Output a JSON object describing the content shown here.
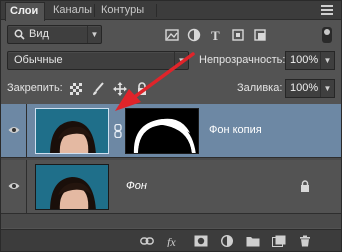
{
  "tabs": [
    {
      "label": "Слои",
      "active": true
    },
    {
      "label": "Каналы",
      "active": false
    },
    {
      "label": "Контуры",
      "active": false
    }
  ],
  "filter": {
    "label": "Вид"
  },
  "blend": {
    "label": "Обычные",
    "opacity_label": "Непрозрачность:",
    "opacity_value": "100%"
  },
  "lock": {
    "label": "Закрепить:",
    "fill_label": "Заливка:",
    "fill_value": "100%"
  },
  "layers": [
    {
      "name": "Фон копия",
      "selected": true,
      "has_mask": true,
      "locked": false
    },
    {
      "name": "Фон",
      "selected": false,
      "has_mask": false,
      "locked": true
    }
  ],
  "footer_icons": [
    "link-icon",
    "fx-icon",
    "add-mask-icon",
    "adjustment-icon",
    "group-icon",
    "new-layer-icon",
    "trash-icon"
  ],
  "colors": {
    "selected_layer": "#6d88a4",
    "annotation_arrow": "#e0242a",
    "panel": "#535353"
  }
}
